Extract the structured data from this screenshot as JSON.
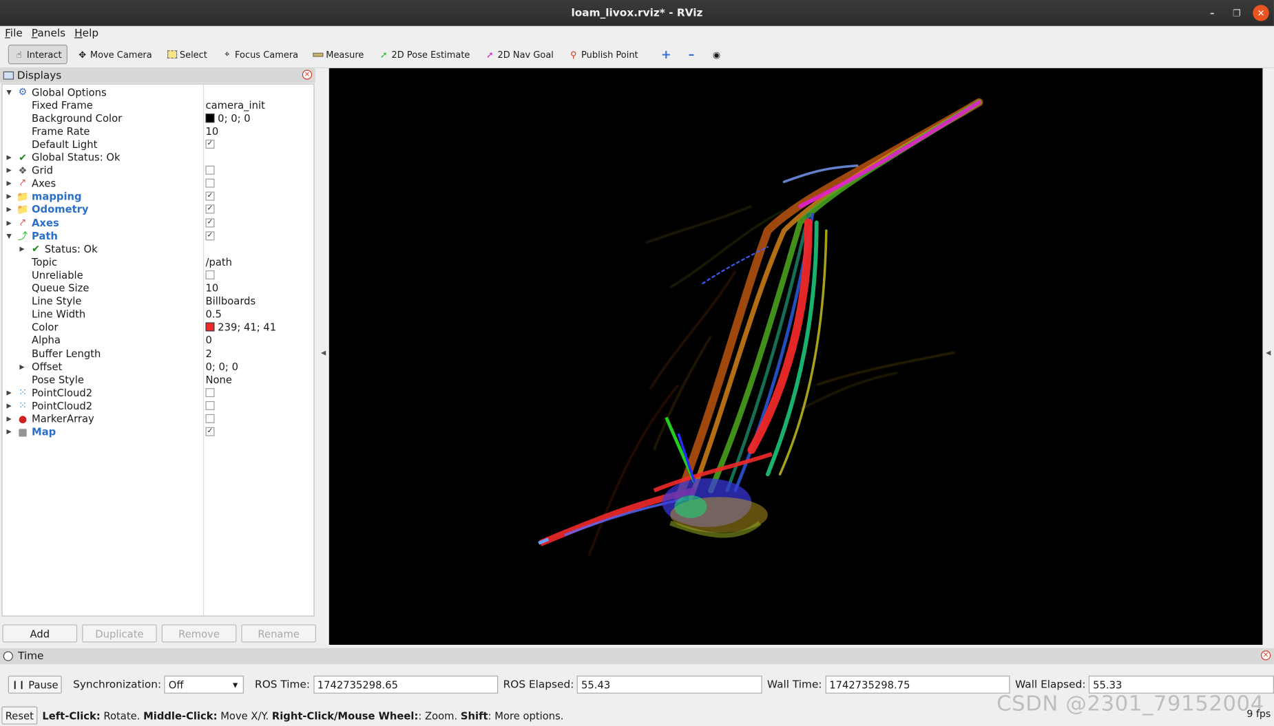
{
  "window": {
    "title": "loam_livox.rviz* - RViz"
  },
  "menu": [
    "File",
    "Panels",
    "Help"
  ],
  "toolbar": {
    "tools": [
      {
        "label": "Interact",
        "icon": "interact-icon",
        "active": true
      },
      {
        "label": "Move Camera",
        "icon": "move-camera-icon"
      },
      {
        "label": "Select",
        "icon": "select-icon"
      },
      {
        "label": "Focus Camera",
        "icon": "focus-camera-icon"
      },
      {
        "label": "Measure",
        "icon": "measure-icon"
      },
      {
        "label": "2D Pose Estimate",
        "icon": "pose-estimate-icon"
      },
      {
        "label": "2D Nav Goal",
        "icon": "nav-goal-icon"
      },
      {
        "label": "Publish Point",
        "icon": "publish-point-icon"
      }
    ]
  },
  "displays": {
    "title": "Displays",
    "rows": [
      {
        "name": "Global Options",
        "indent": 0,
        "expanded": true,
        "icon": "gear-icon"
      },
      {
        "name": "Fixed Frame",
        "indent": 1,
        "value": "camera_init"
      },
      {
        "name": "Background Color",
        "indent": 1,
        "value": "0; 0; 0",
        "swatch": "#000000"
      },
      {
        "name": "Frame Rate",
        "indent": 1,
        "value": "10"
      },
      {
        "name": "Default Light",
        "indent": 1,
        "checkbox": true
      },
      {
        "name": "Global Status: Ok",
        "indent": 0,
        "collapsed": true,
        "icon": "check-icon"
      },
      {
        "name": "Grid",
        "indent": 0,
        "collapsed": true,
        "icon": "grid-icon",
        "checkbox": false
      },
      {
        "name": "Axes",
        "indent": 0,
        "collapsed": true,
        "icon": "axes-icon",
        "checkbox": false
      },
      {
        "name": "mapping",
        "indent": 0,
        "collapsed": true,
        "icon": "folder-icon",
        "checkbox": true,
        "bold": true
      },
      {
        "name": "Odometry",
        "indent": 0,
        "collapsed": true,
        "icon": "folder-icon",
        "checkbox": true,
        "bold": true
      },
      {
        "name": "Axes",
        "indent": 0,
        "collapsed": true,
        "icon": "axes-icon",
        "checkbox": true,
        "bold": true
      },
      {
        "name": "Path",
        "indent": 0,
        "expanded": true,
        "icon": "path-icon",
        "checkbox": true,
        "bold": true
      },
      {
        "name": "Status: Ok",
        "indent": 1,
        "collapsed": true,
        "icon": "check-icon"
      },
      {
        "name": "Topic",
        "indent": 1,
        "value": "/path"
      },
      {
        "name": "Unreliable",
        "indent": 1,
        "checkbox": false
      },
      {
        "name": "Queue Size",
        "indent": 1,
        "value": "10"
      },
      {
        "name": "Line Style",
        "indent": 1,
        "value": "Billboards"
      },
      {
        "name": "Line Width",
        "indent": 1,
        "value": "0.5"
      },
      {
        "name": "Color",
        "indent": 1,
        "value": "239; 41; 41",
        "swatch": "#ef2929"
      },
      {
        "name": "Alpha",
        "indent": 1,
        "value": "0"
      },
      {
        "name": "Buffer Length",
        "indent": 1,
        "value": "2"
      },
      {
        "name": "Offset",
        "indent": 1,
        "value": "0; 0; 0",
        "collapsed": true
      },
      {
        "name": "Pose Style",
        "indent": 1,
        "value": "None"
      },
      {
        "name": "PointCloud2",
        "indent": 0,
        "collapsed": true,
        "icon": "pointcloud-icon",
        "checkbox": false
      },
      {
        "name": "PointCloud2",
        "indent": 0,
        "collapsed": true,
        "icon": "pointcloud-icon",
        "checkbox": false
      },
      {
        "name": "MarkerArray",
        "indent": 0,
        "collapsed": true,
        "icon": "marker-icon",
        "checkbox": false
      },
      {
        "name": "Map",
        "indent": 0,
        "collapsed": true,
        "icon": "map-icon",
        "checkbox": true,
        "bold": true
      }
    ],
    "buttons": {
      "add": "Add",
      "duplicate": "Duplicate",
      "remove": "Remove",
      "rename": "Rename"
    }
  },
  "time": {
    "title": "Time",
    "pause": "Pause",
    "sync_label": "Synchronization:",
    "sync_value": "Off",
    "ros_time_label": "ROS Time:",
    "ros_time": "1742735298.65",
    "ros_elapsed_label": "ROS Elapsed:",
    "ros_elapsed": "55.43",
    "wall_time_label": "Wall Time:",
    "wall_time": "1742735298.75",
    "wall_elapsed_label": "Wall Elapsed:",
    "wall_elapsed": "55.33"
  },
  "status": {
    "reset": "Reset",
    "hint_lc": "Left-Click:",
    "hint_lc_t": " Rotate. ",
    "hint_mc": "Middle-Click:",
    "hint_mc_t": " Move X/Y. ",
    "hint_rc": "Right-Click/Mouse Wheel:",
    "hint_rc_t": ": Zoom. ",
    "hint_sh": "Shift",
    "hint_sh_t": ": More options.",
    "fps": "9 fps"
  },
  "watermark": "CSDN @2301_79152004"
}
